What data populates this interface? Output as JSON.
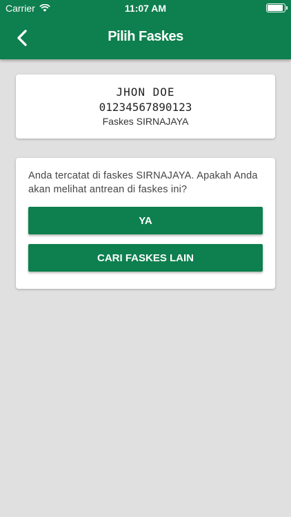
{
  "status_bar": {
    "carrier": "Carrier",
    "time": "11:07 AM"
  },
  "header": {
    "title": "Pilih Faskes"
  },
  "patient": {
    "name": "JHON DOE",
    "card_number": "01234567890123",
    "faskes": "Faskes SIRNAJAYA"
  },
  "prompt": {
    "question": "Anda tercatat di faskes SIRNAJAYA. Apakah Anda akan melihat antrean di faskes ini?",
    "yes_label": "YA",
    "other_label": "CARI FASKES LAIN"
  },
  "colors": {
    "primary": "#0e7f4e",
    "background": "#e0e0e0"
  },
  "icons": {
    "back": "chevron-left-icon",
    "wifi": "wifi-icon",
    "battery": "battery-icon"
  }
}
